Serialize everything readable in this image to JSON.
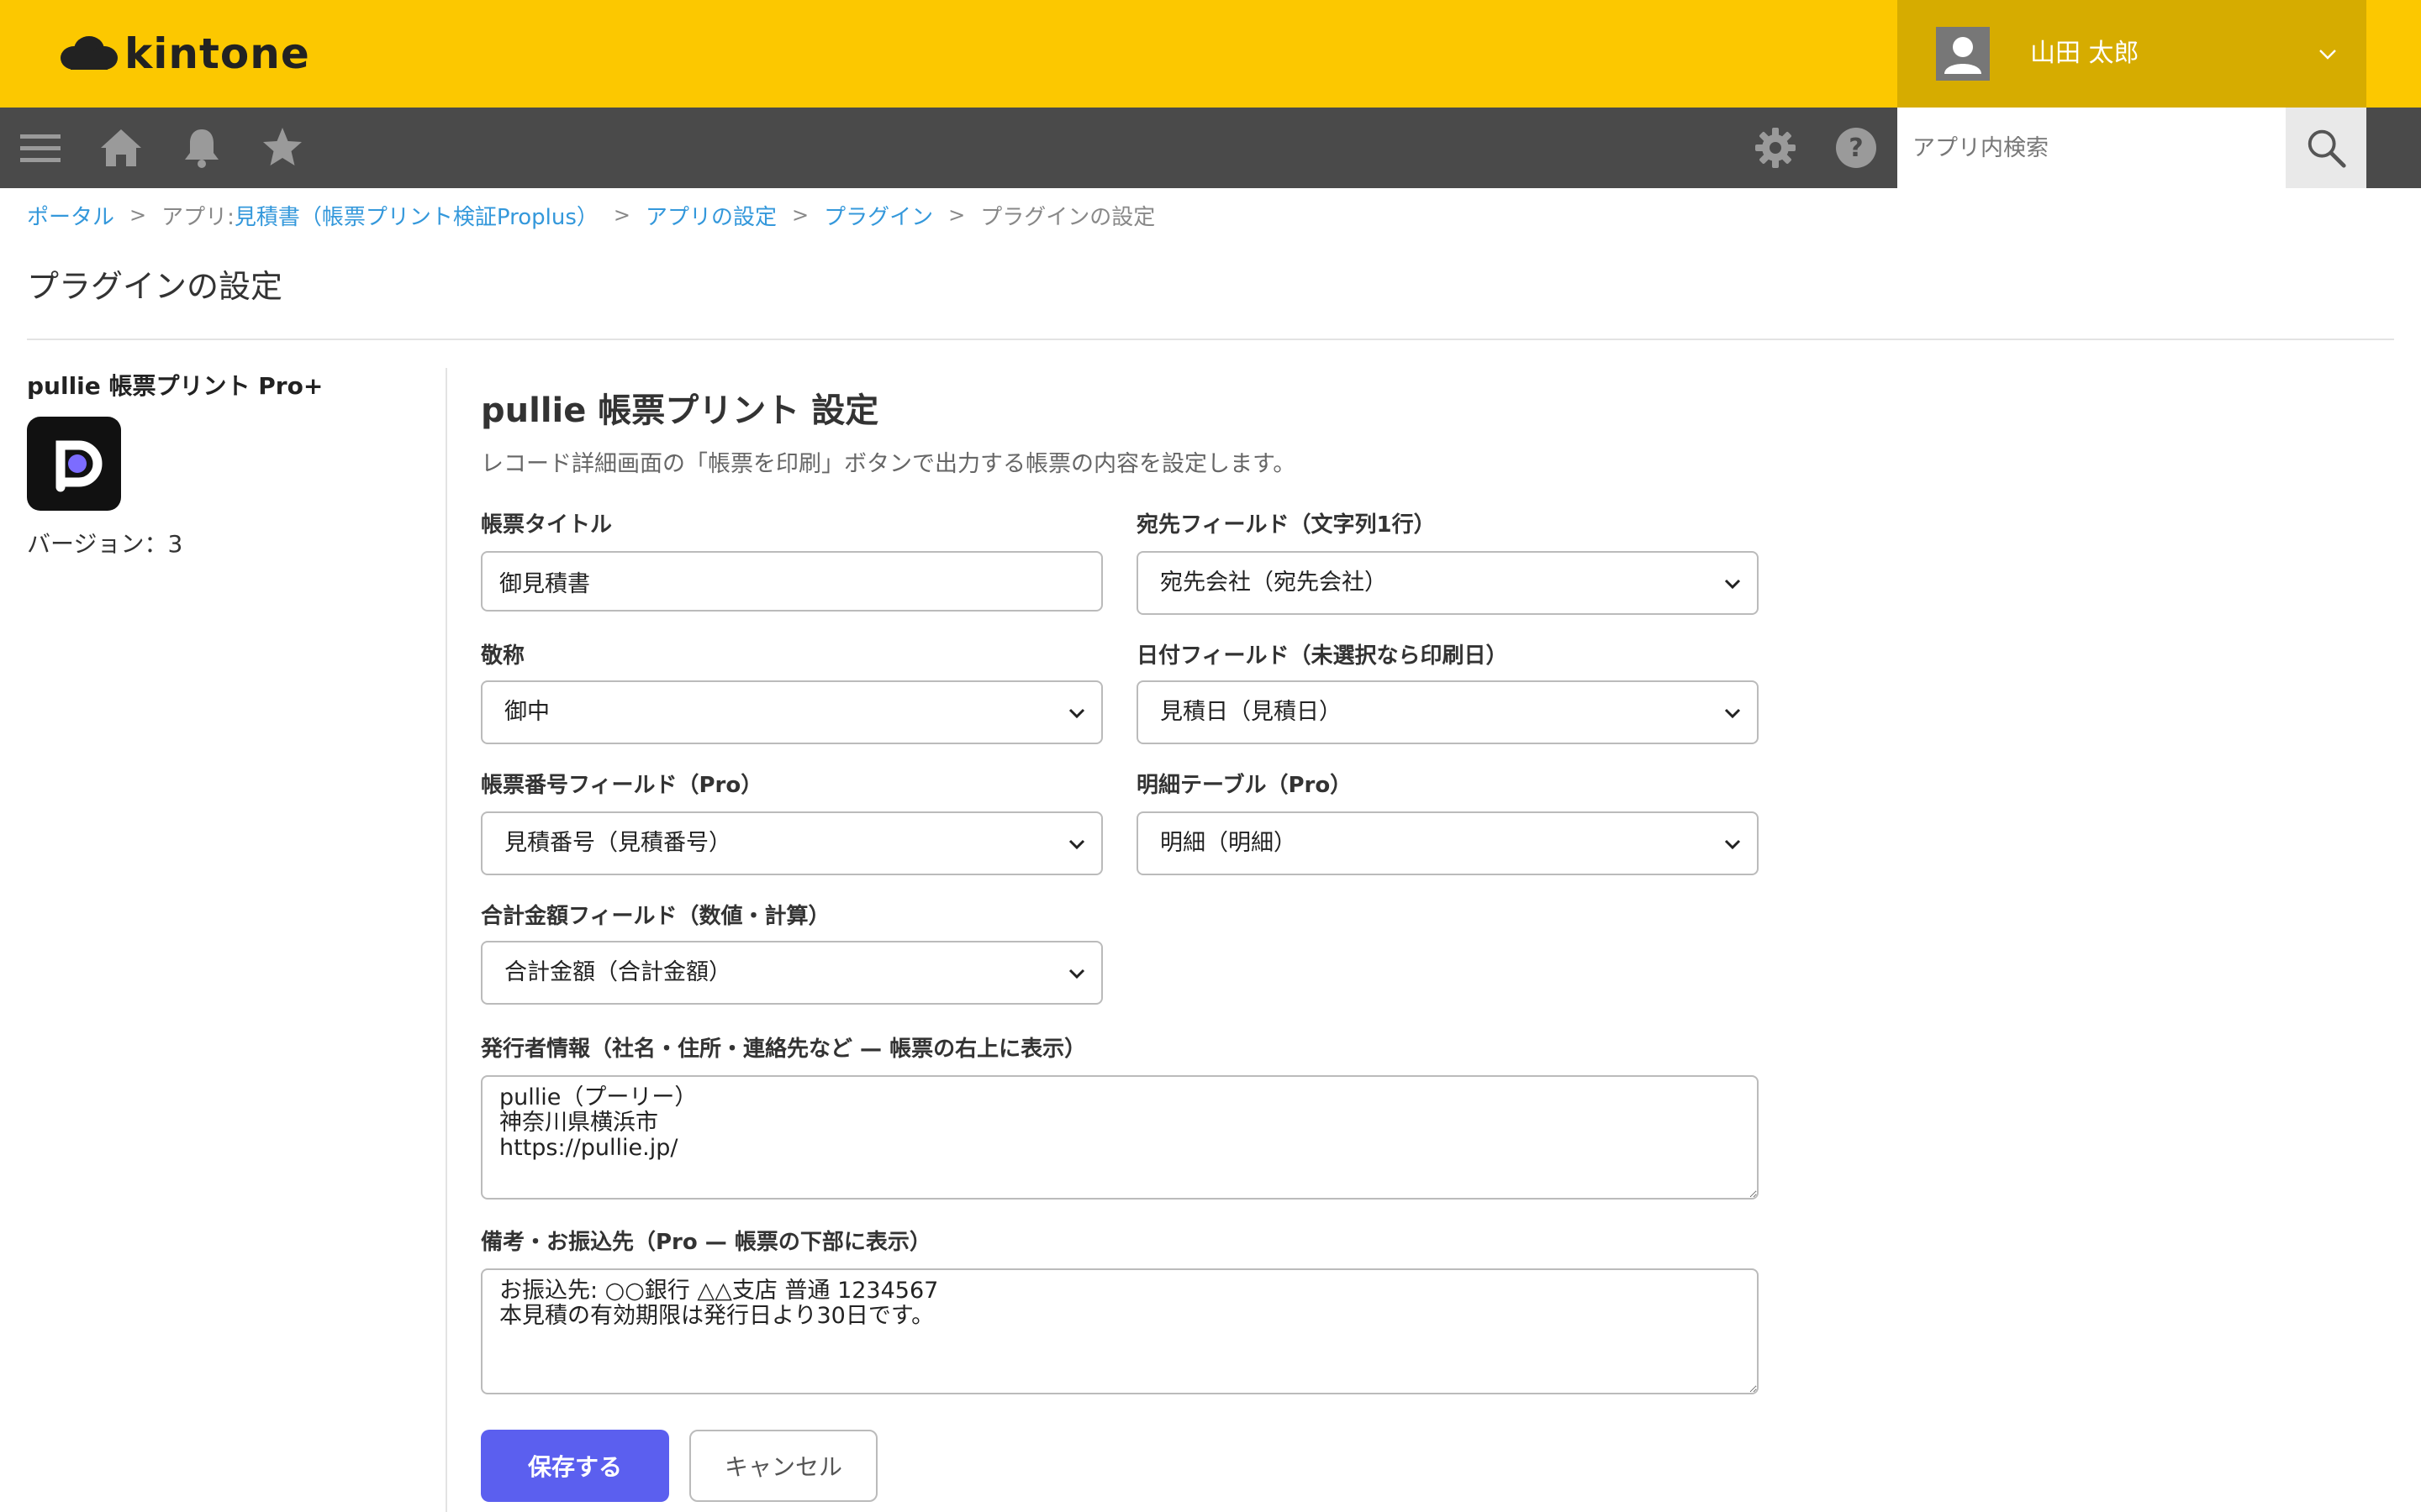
{
  "header": {
    "logo_text": "kintone",
    "user_name": "山田 太郎",
    "brand_color": "#fcc800",
    "user_area_color": "#d6ac00"
  },
  "navbar": {
    "icons": [
      "menu-icon",
      "home-icon",
      "bell-icon",
      "star-icon",
      "gear-icon",
      "help-icon"
    ],
    "search_placeholder": "アプリ内検索",
    "search_value": ""
  },
  "breadcrumb": {
    "portal": "ポータル",
    "app_prefix": "アプリ: ",
    "app_name": "見積書（帳票プリント検証Proplus）",
    "app_settings": "アプリの設定",
    "plugins": "プラグイン",
    "current": "プラグインの設定",
    "separator": ">"
  },
  "page_title": "プラグインの設定",
  "sidebar": {
    "plugin_name": "pullie 帳票プリント Pro+",
    "version_text": "バージョン：3"
  },
  "form": {
    "title": "pullie 帳票プリント 設定",
    "description": "レコード詳細画面の「帳票を印刷」ボタンで出力する帳票の内容を設定します。",
    "doc_title": {
      "label": "帳票タイトル",
      "value": "御見積書"
    },
    "recipient_field": {
      "label": "宛先フィールド（文字列1行）",
      "selected": "宛先会社（宛先会社）"
    },
    "honorific": {
      "label": "敬称",
      "selected": "御中"
    },
    "date_field": {
      "label": "日付フィールド（未選択なら印刷日）",
      "selected": "見積日（見積日）"
    },
    "number_field": {
      "label": "帳票番号フィールド（Pro）",
      "selected": "見積番号（見積番号）"
    },
    "detail_table": {
      "label": "明細テーブル（Pro）",
      "selected": "明細（明細）"
    },
    "total_field": {
      "label": "合計金額フィールド（数値・計算）",
      "selected": "合計金額（合計金額）"
    },
    "issuer_info": {
      "label": "発行者情報（社名・住所・連絡先など — 帳票の右上に表示）",
      "value": "pullie（プーリー）\n神奈川県横浜市\nhttps://pullie.jp/"
    },
    "remarks": {
      "label": "備考・お振込先（Pro — 帳票の下部に表示）",
      "value": "お振込先: ○○銀行 △△支店 普通 1234567\n本見積の有効期限は発行日より30日です。"
    },
    "save_label": "保存する",
    "cancel_label": "キャンセル",
    "accent_color": "#5b5fef"
  }
}
